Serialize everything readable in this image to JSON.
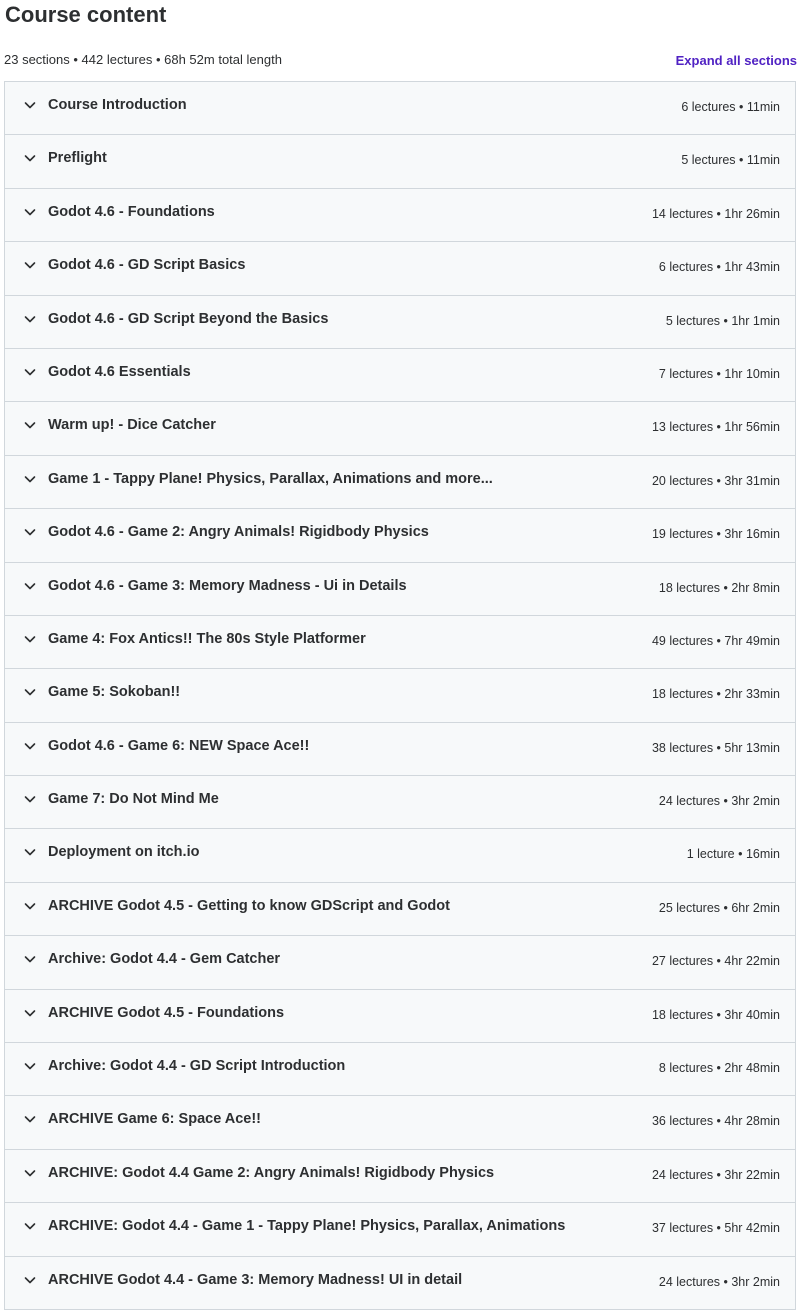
{
  "header": {
    "title": "Course content",
    "stats": "23 sections • 442 lectures • 68h 52m total length",
    "expand_label": "Expand all sections"
  },
  "icons": {
    "chevron": "chevron-down-icon"
  },
  "sections": [
    {
      "title": "Course Introduction",
      "meta": "6 lectures • 11min"
    },
    {
      "title": "Preflight",
      "meta": "5 lectures • 11min"
    },
    {
      "title": "Godot 4.6 - Foundations",
      "meta": "14 lectures • 1hr 26min"
    },
    {
      "title": "Godot 4.6 - GD Script Basics",
      "meta": "6 lectures • 1hr 43min"
    },
    {
      "title": "Godot 4.6 - GD Script Beyond the Basics",
      "meta": "5 lectures • 1hr 1min"
    },
    {
      "title": "Godot 4.6 Essentials",
      "meta": "7 lectures • 1hr 10min"
    },
    {
      "title": "Warm up! - Dice Catcher",
      "meta": "13 lectures • 1hr 56min"
    },
    {
      "title": "Game 1 - Tappy Plane! Physics, Parallax, Animations and more...",
      "meta": "20 lectures • 3hr 31min"
    },
    {
      "title": "Godot 4.6 - Game 2: Angry Animals! Rigidbody Physics",
      "meta": "19 lectures • 3hr 16min"
    },
    {
      "title": "Godot 4.6 - Game 3: Memory Madness - Ui in Details",
      "meta": "18 lectures • 2hr 8min"
    },
    {
      "title": "Game 4: Fox Antics!! The 80s Style Platformer",
      "meta": "49 lectures • 7hr 49min"
    },
    {
      "title": "Game 5: Sokoban!!",
      "meta": "18 lectures • 2hr 33min"
    },
    {
      "title": "Godot 4.6 - Game 6: NEW Space Ace!!",
      "meta": "38 lectures • 5hr 13min"
    },
    {
      "title": "Game 7: Do Not Mind Me",
      "meta": "24 lectures • 3hr 2min"
    },
    {
      "title": "Deployment on itch.io",
      "meta": "1 lecture • 16min"
    },
    {
      "title": "ARCHIVE Godot 4.5 - Getting to know GDScript and Godot",
      "meta": "25 lectures • 6hr 2min"
    },
    {
      "title": "Archive: Godot 4.4 - Gem Catcher",
      "meta": "27 lectures • 4hr 22min"
    },
    {
      "title": "ARCHIVE Godot 4.5 - Foundations",
      "meta": "18 lectures • 3hr 40min"
    },
    {
      "title": "Archive: Godot 4.4 - GD Script Introduction",
      "meta": "8 lectures • 2hr 48min"
    },
    {
      "title": "ARCHIVE Game 6: Space Ace!!",
      "meta": "36 lectures • 4hr 28min"
    },
    {
      "title": "ARCHIVE: Godot 4.4 Game 2: Angry Animals! Rigidbody Physics",
      "meta": "24 lectures • 3hr 22min"
    },
    {
      "title": "ARCHIVE: Godot 4.4 - Game 1 - Tappy Plane! Physics, Parallax, Animations",
      "meta": "37 lectures • 5hr 42min"
    },
    {
      "title": "ARCHIVE Godot 4.4 - Game 3: Memory Madness! UI in detail",
      "meta": "24 lectures • 3hr 2min"
    }
  ]
}
